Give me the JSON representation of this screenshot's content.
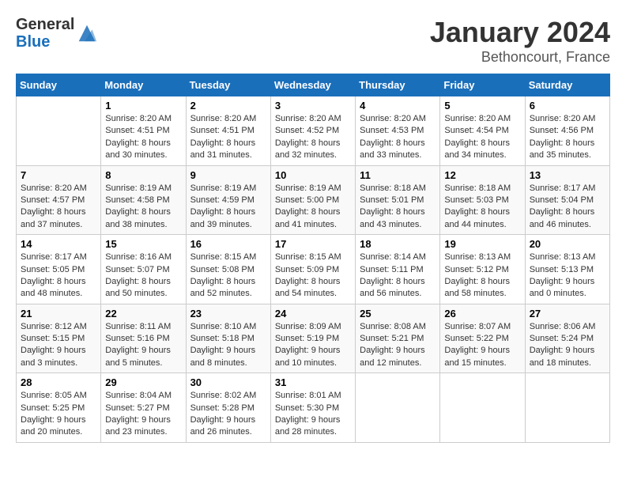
{
  "header": {
    "logo_general": "General",
    "logo_blue": "Blue",
    "month": "January 2024",
    "location": "Bethoncourt, France"
  },
  "days_of_week": [
    "Sunday",
    "Monday",
    "Tuesday",
    "Wednesday",
    "Thursday",
    "Friday",
    "Saturday"
  ],
  "weeks": [
    [
      {
        "day": "",
        "info": ""
      },
      {
        "day": "1",
        "info": "Sunrise: 8:20 AM\nSunset: 4:51 PM\nDaylight: 8 hours\nand 30 minutes."
      },
      {
        "day": "2",
        "info": "Sunrise: 8:20 AM\nSunset: 4:51 PM\nDaylight: 8 hours\nand 31 minutes."
      },
      {
        "day": "3",
        "info": "Sunrise: 8:20 AM\nSunset: 4:52 PM\nDaylight: 8 hours\nand 32 minutes."
      },
      {
        "day": "4",
        "info": "Sunrise: 8:20 AM\nSunset: 4:53 PM\nDaylight: 8 hours\nand 33 minutes."
      },
      {
        "day": "5",
        "info": "Sunrise: 8:20 AM\nSunset: 4:54 PM\nDaylight: 8 hours\nand 34 minutes."
      },
      {
        "day": "6",
        "info": "Sunrise: 8:20 AM\nSunset: 4:56 PM\nDaylight: 8 hours\nand 35 minutes."
      }
    ],
    [
      {
        "day": "7",
        "info": "Sunrise: 8:20 AM\nSunset: 4:57 PM\nDaylight: 8 hours\nand 37 minutes."
      },
      {
        "day": "8",
        "info": "Sunrise: 8:19 AM\nSunset: 4:58 PM\nDaylight: 8 hours\nand 38 minutes."
      },
      {
        "day": "9",
        "info": "Sunrise: 8:19 AM\nSunset: 4:59 PM\nDaylight: 8 hours\nand 39 minutes."
      },
      {
        "day": "10",
        "info": "Sunrise: 8:19 AM\nSunset: 5:00 PM\nDaylight: 8 hours\nand 41 minutes."
      },
      {
        "day": "11",
        "info": "Sunrise: 8:18 AM\nSunset: 5:01 PM\nDaylight: 8 hours\nand 43 minutes."
      },
      {
        "day": "12",
        "info": "Sunrise: 8:18 AM\nSunset: 5:03 PM\nDaylight: 8 hours\nand 44 minutes."
      },
      {
        "day": "13",
        "info": "Sunrise: 8:17 AM\nSunset: 5:04 PM\nDaylight: 8 hours\nand 46 minutes."
      }
    ],
    [
      {
        "day": "14",
        "info": "Sunrise: 8:17 AM\nSunset: 5:05 PM\nDaylight: 8 hours\nand 48 minutes."
      },
      {
        "day": "15",
        "info": "Sunrise: 8:16 AM\nSunset: 5:07 PM\nDaylight: 8 hours\nand 50 minutes."
      },
      {
        "day": "16",
        "info": "Sunrise: 8:15 AM\nSunset: 5:08 PM\nDaylight: 8 hours\nand 52 minutes."
      },
      {
        "day": "17",
        "info": "Sunrise: 8:15 AM\nSunset: 5:09 PM\nDaylight: 8 hours\nand 54 minutes."
      },
      {
        "day": "18",
        "info": "Sunrise: 8:14 AM\nSunset: 5:11 PM\nDaylight: 8 hours\nand 56 minutes."
      },
      {
        "day": "19",
        "info": "Sunrise: 8:13 AM\nSunset: 5:12 PM\nDaylight: 8 hours\nand 58 minutes."
      },
      {
        "day": "20",
        "info": "Sunrise: 8:13 AM\nSunset: 5:13 PM\nDaylight: 9 hours\nand 0 minutes."
      }
    ],
    [
      {
        "day": "21",
        "info": "Sunrise: 8:12 AM\nSunset: 5:15 PM\nDaylight: 9 hours\nand 3 minutes."
      },
      {
        "day": "22",
        "info": "Sunrise: 8:11 AM\nSunset: 5:16 PM\nDaylight: 9 hours\nand 5 minutes."
      },
      {
        "day": "23",
        "info": "Sunrise: 8:10 AM\nSunset: 5:18 PM\nDaylight: 9 hours\nand 8 minutes."
      },
      {
        "day": "24",
        "info": "Sunrise: 8:09 AM\nSunset: 5:19 PM\nDaylight: 9 hours\nand 10 minutes."
      },
      {
        "day": "25",
        "info": "Sunrise: 8:08 AM\nSunset: 5:21 PM\nDaylight: 9 hours\nand 12 minutes."
      },
      {
        "day": "26",
        "info": "Sunrise: 8:07 AM\nSunset: 5:22 PM\nDaylight: 9 hours\nand 15 minutes."
      },
      {
        "day": "27",
        "info": "Sunrise: 8:06 AM\nSunset: 5:24 PM\nDaylight: 9 hours\nand 18 minutes."
      }
    ],
    [
      {
        "day": "28",
        "info": "Sunrise: 8:05 AM\nSunset: 5:25 PM\nDaylight: 9 hours\nand 20 minutes."
      },
      {
        "day": "29",
        "info": "Sunrise: 8:04 AM\nSunset: 5:27 PM\nDaylight: 9 hours\nand 23 minutes."
      },
      {
        "day": "30",
        "info": "Sunrise: 8:02 AM\nSunset: 5:28 PM\nDaylight: 9 hours\nand 26 minutes."
      },
      {
        "day": "31",
        "info": "Sunrise: 8:01 AM\nSunset: 5:30 PM\nDaylight: 9 hours\nand 28 minutes."
      },
      {
        "day": "",
        "info": ""
      },
      {
        "day": "",
        "info": ""
      },
      {
        "day": "",
        "info": ""
      }
    ]
  ]
}
